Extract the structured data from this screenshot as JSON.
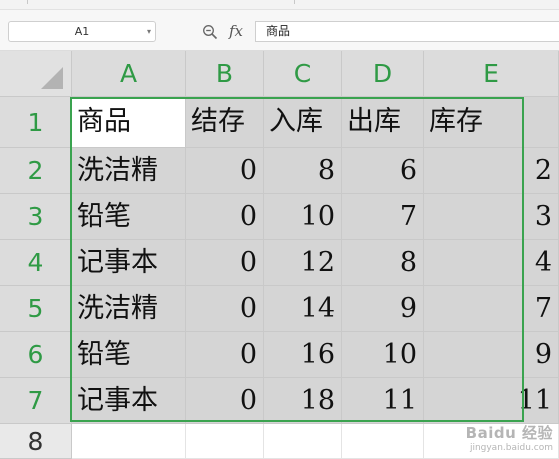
{
  "formula_bar": {
    "cell_ref": "A1",
    "fx_label": "fx",
    "content": "商品"
  },
  "columns": [
    "A",
    "B",
    "C",
    "D",
    "E"
  ],
  "rows": [
    "1",
    "2",
    "3",
    "4",
    "5",
    "6",
    "7",
    "8"
  ],
  "sheet": {
    "header": [
      "商品",
      "结存",
      "入库",
      "出库",
      "库存"
    ],
    "records": [
      [
        "洗洁精",
        "0",
        "8",
        "6",
        "2"
      ],
      [
        "铅笔",
        "0",
        "10",
        "7",
        "3"
      ],
      [
        "记事本",
        "0",
        "12",
        "8",
        "4"
      ],
      [
        "洗洁精",
        "0",
        "14",
        "9",
        "7"
      ],
      [
        "铅笔",
        "0",
        "16",
        "10",
        "9"
      ],
      [
        "记事本",
        "0",
        "18",
        "11",
        "11"
      ]
    ]
  },
  "colors": {
    "selection_border": "#3aa34f",
    "header_text": "#2f9a45",
    "selected_fill": "#d5d5d5"
  },
  "watermark": {
    "main": "Baidu 经验",
    "sub": "jingyan.baidu.com"
  }
}
